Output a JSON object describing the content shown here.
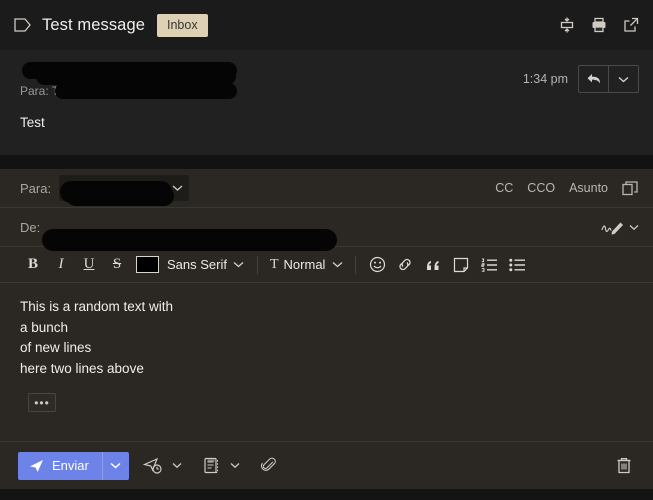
{
  "header": {
    "tag_icon": "label-tag-icon",
    "subject": "Test message",
    "inbox_chip": "Inbox",
    "icons": [
      {
        "name": "collapse-all-icon"
      },
      {
        "name": "print-icon"
      },
      {
        "name": "open-in-new-window-icon"
      }
    ]
  },
  "message": {
    "from_name": "",
    "to_prefix": "Para: Tú",
    "time": "1:34 pm",
    "reply_label": "reply-icon",
    "more_label": "chevron-down-icon",
    "body": "Test"
  },
  "compose": {
    "to_label": "Para:",
    "to_value": "",
    "from_label": "De:",
    "from_value": "",
    "cc_label": "CC",
    "bcc_label": "CCO",
    "subject_label": "Asunto",
    "popout_icon": "popout-icon",
    "signature_icon": "signature-pen-icon",
    "toolbar": {
      "bold": "B",
      "italic": "I",
      "underline": "U",
      "strikethrough": "S",
      "text_color": "#000000",
      "font_family": "Sans Serif",
      "size_icon": "T",
      "font_size": "Normal",
      "emoji": "emoji-icon",
      "link": "link-icon",
      "quote": "quote-icon",
      "code": "code-block-icon",
      "numbered_list": "numbered-list-icon",
      "bulleted_list": "bulleted-list-icon"
    },
    "body_lines": [
      "This is a random text with",
      "a bunch",
      "of new lines",
      "here two lines above"
    ],
    "trimmed_content": "•••"
  },
  "bottom": {
    "send_label": "Enviar",
    "send_icon": "send-plane-icon",
    "send_caret": "chevron-down-icon",
    "schedule_icon": "schedule-send-icon",
    "schedule_caret": "chevron-down-icon",
    "template_icon": "template-icon",
    "template_caret": "chevron-down-icon",
    "attach_icon": "attach-paperclip-icon",
    "discard_icon": "trash-icon"
  },
  "colors": {
    "header_bg": "#1b1b1b",
    "message_bg": "#212121",
    "compose_bg": "#2b2823",
    "accent_send": "#6d83e8",
    "inbox_chip": "#ddd0b5",
    "redaction": "#050505"
  }
}
